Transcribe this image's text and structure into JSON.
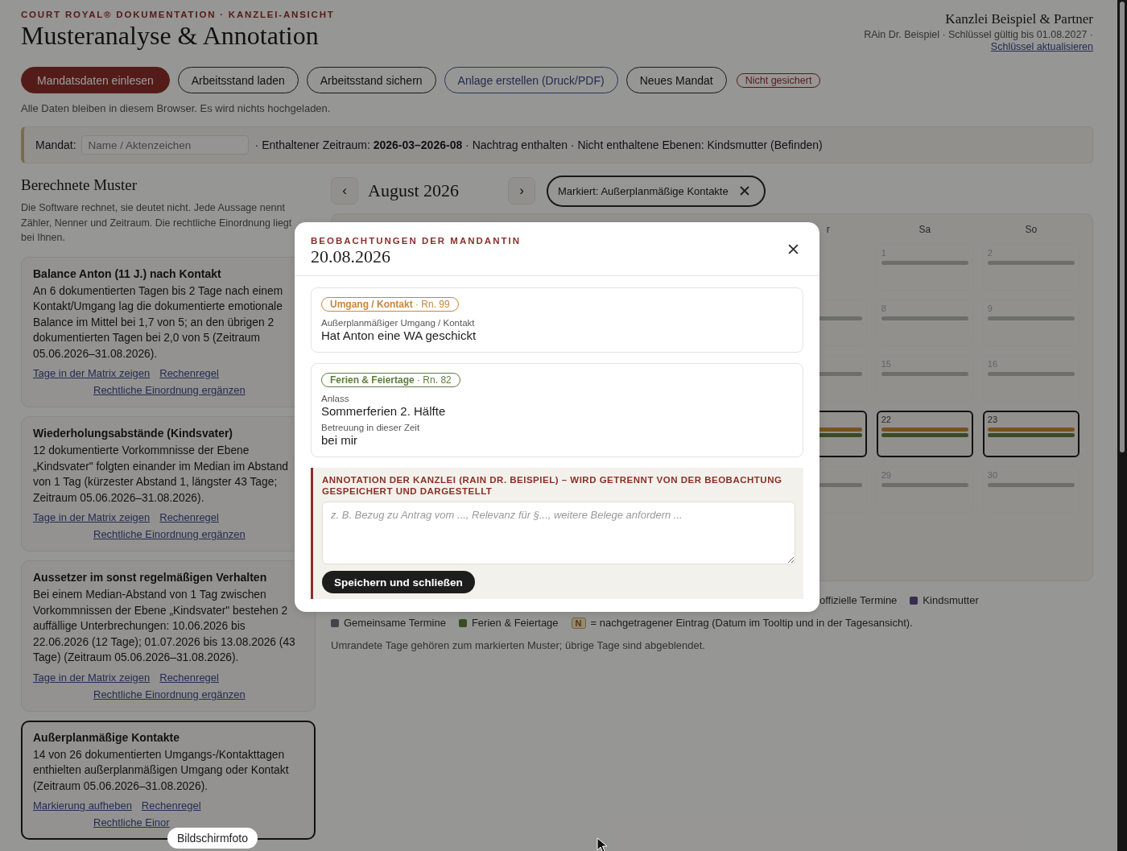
{
  "header": {
    "eyebrow": "COURT ROYAL® DOKUMENTATION · KANZLEI-ANSICHT",
    "title": "Musteranalyse & Annotation",
    "firm": "Kanzlei Beispiel & Partner",
    "license": "RAin Dr. Beispiel · Schlüssel gültig bis 01.08.2027 ·",
    "license_link": "Schlüssel aktualisieren"
  },
  "toolbar": {
    "buttons": [
      {
        "label": "Mandatsdaten einlesen",
        "kind": "primary"
      },
      {
        "label": "Arbeitsstand laden",
        "kind": "outline"
      },
      {
        "label": "Arbeitsstand sichern",
        "kind": "outline"
      },
      {
        "label": "Anlage erstellen (Druck/PDF)",
        "kind": "accent"
      },
      {
        "label": "Neues Mandat",
        "kind": "outline"
      }
    ],
    "status": "Nicht gesichert",
    "note": "Alle Daten bleiben in diesem Browser. Es wird nichts hochgeladen."
  },
  "mandate_bar": {
    "label": "Mandat:",
    "placeholder": "Name / Aktenzeichen",
    "summary": "· Enthaltener Zeitraum: **2026-03–2026-08** · Nachtrag enthalten · Nicht enthaltene Ebenen: Kindsmutter (Befinden)"
  },
  "patterns": {
    "title": "Berechnete Muster",
    "intro": "Die Software rechnet, sie deutet nicht. Jede Aussage nennt Zähler, Nenner und Zeitraum. Die rechtliche Einordnung liegt bei Ihnen.",
    "cards": [
      {
        "title": "Balance Anton (11 J.) nach Kontakt",
        "text": "An 6 dokumentierten Tagen bis 2 Tage nach einem Kontakt/Umgang lag die dokumentierte emotionale Balance im Mittel bei 1,7 von 5; an den übrigen 2 dokumentierten Tagen bei 2,0 von 5 (Zeitraum 05.06.2026–31.08.2026).",
        "links": [
          "Tage in der Matrix zeigen",
          "Rechenregel",
          "Rechtliche Einordnung ergänzen"
        ],
        "selected": false
      },
      {
        "title": "Wiederholungsabstände (Kindsvater)",
        "text": "12 dokumentierte Vorkommnisse der Ebene „Kindsvater\" folgten einander im Median im Abstand von 1 Tag (kürzester Abstand 1, längster 43 Tage; Zeitraum 05.06.2026–31.08.2026).",
        "links": [
          "Tage in der Matrix zeigen",
          "Rechenregel",
          "Rechtliche Einordnung ergänzen"
        ],
        "selected": false
      },
      {
        "title": "Aussetzer im sonst regelmäßigen Verhalten",
        "text": "Bei einem Median-Abstand von 1 Tag zwischen Vorkommnissen der Ebene „Kindsvater\" bestehen 2 auffällige Unterbrechungen: 10.06.2026 bis 22.06.2026 (12 Tage); 01.07.2026 bis 13.08.2026 (43 Tage) (Zeitraum 05.06.2026–31.08.2026).",
        "links": [
          "Tage in der Matrix zeigen",
          "Rechenregel",
          "Rechtliche Einordnung ergänzen"
        ],
        "selected": false
      },
      {
        "title": "Außerplanmäßige Kontakte",
        "text": "14 von 26 dokumentierten Umgangs-/Kontakttagen enthielten außerplanmäßigen Umgang oder Kontakt (Zeitraum 05.06.2026–31.08.2026).",
        "links": [
          "Markierung aufheben",
          "Rechenregel",
          "Rechtliche Einor"
        ],
        "selected": true
      }
    ]
  },
  "calendar": {
    "prev": "‹",
    "month": "August 2026",
    "next": "›",
    "marker": "Markiert: Außerplanmäßige Kontakte",
    "weekdays": [
      {
        "label": "r"
      },
      {
        "label": "Sa"
      },
      {
        "label": "So"
      }
    ],
    "weeks": [
      {
        "cells": [
          null,
          {
            "day": "1",
            "marked": false,
            "layers": [
              {
                "kind": "ferien"
              }
            ]
          },
          {
            "day": "2",
            "marked": false,
            "layers": [
              {
                "kind": "ferien"
              }
            ]
          }
        ]
      },
      {
        "cells": [
          {
            "marked": false,
            "layers": [
              {
                "kind": "ferien"
              }
            ]
          },
          {
            "day": "8",
            "marked": false,
            "layers": [
              {
                "kind": "ferien"
              }
            ]
          },
          {
            "day": "9",
            "marked": false,
            "layers": [
              {
                "kind": "ferien"
              }
            ]
          }
        ]
      },
      {
        "cells": [
          {
            "marked": false,
            "layers": [
              {
                "kind": "ferien"
              }
            ]
          },
          {
            "day": "15",
            "marked": false,
            "layers": [
              {
                "kind": "ferien"
              }
            ]
          },
          {
            "day": "16",
            "marked": false,
            "layers": [
              {
                "kind": "ferien"
              }
            ]
          }
        ]
      },
      {
        "cells": [
          {
            "marked": true,
            "layers": [
              {
                "kind": "umgang"
              },
              {
                "kind": "ferien"
              }
            ]
          },
          {
            "day": "22",
            "marked": true,
            "layers": [
              {
                "kind": "umgang"
              },
              {
                "kind": "ferien"
              }
            ]
          },
          {
            "day": "23",
            "marked": true,
            "layers": [
              {
                "kind": "umgang"
              },
              {
                "kind": "ferien"
              }
            ]
          }
        ]
      },
      {
        "cells": [
          {
            "marked": false,
            "layers": [
              {
                "kind": "ferien"
              }
            ]
          },
          {
            "day": "29",
            "marked": false,
            "layers": [
              {
                "kind": "ferien"
              }
            ]
          },
          {
            "day": "30",
            "marked": false,
            "layers": [
              {
                "kind": "ferien"
              }
            ]
          }
        ]
      }
    ],
    "legend_rows": [
      [
        {
          "label": "offizielle Termine",
          "kind": "text"
        },
        {
          "label": "Kindsmutter",
          "kind": "dot",
          "color": "#372d53"
        }
      ],
      [
        {
          "label": "Gemeinsame Termine",
          "kind": "dot",
          "color": "#40444d"
        },
        {
          "label": "Ferien & Feiertage",
          "kind": "dot",
          "color": "#394b24"
        },
        {
          "badge": "N",
          "label": "= nachgetragener Eintrag (Datum im Tooltip und in der Tagesansicht).",
          "kind": "badge"
        }
      ]
    ],
    "note": "Umrandete Tage gehören zum markierten Muster; übrige Tage sind abgeblendet."
  },
  "modal": {
    "eyebrow": "BEOBACHTUNGEN DER MANDANTIN",
    "date": "20.08.2026",
    "entries": [
      {
        "tag": "**Umgang / Kontakt** · Rn. 99",
        "kind": "umgang",
        "fields": [
          {
            "label": "Außerplanmäßiger Umgang / Kontakt",
            "value": "Hat Anton eine WA geschickt"
          }
        ]
      },
      {
        "tag": "**Ferien & Feiertage** · Rn. 82",
        "kind": "ferien",
        "fields": [
          {
            "label": "Anlass",
            "value": "Sommerferien 2. Hälfte"
          },
          {
            "label": "Betreuung in dieser Zeit",
            "value": "bei mir"
          }
        ]
      }
    ],
    "annotation": {
      "label": "ANNOTATION DER KANZLEI (RAIN DR. BEISPIEL) – WIRD GETRENNT VON DER BEOBACHTUNG GESPEICHERT UND DARGESTELLT",
      "placeholder": "z. B. Bezug zu Antrag vom ..., Relevanz für §..., weitere Belege anfordern ...",
      "button": "Speichern und schließen"
    }
  },
  "tooltip": "Bildschirmfoto"
}
